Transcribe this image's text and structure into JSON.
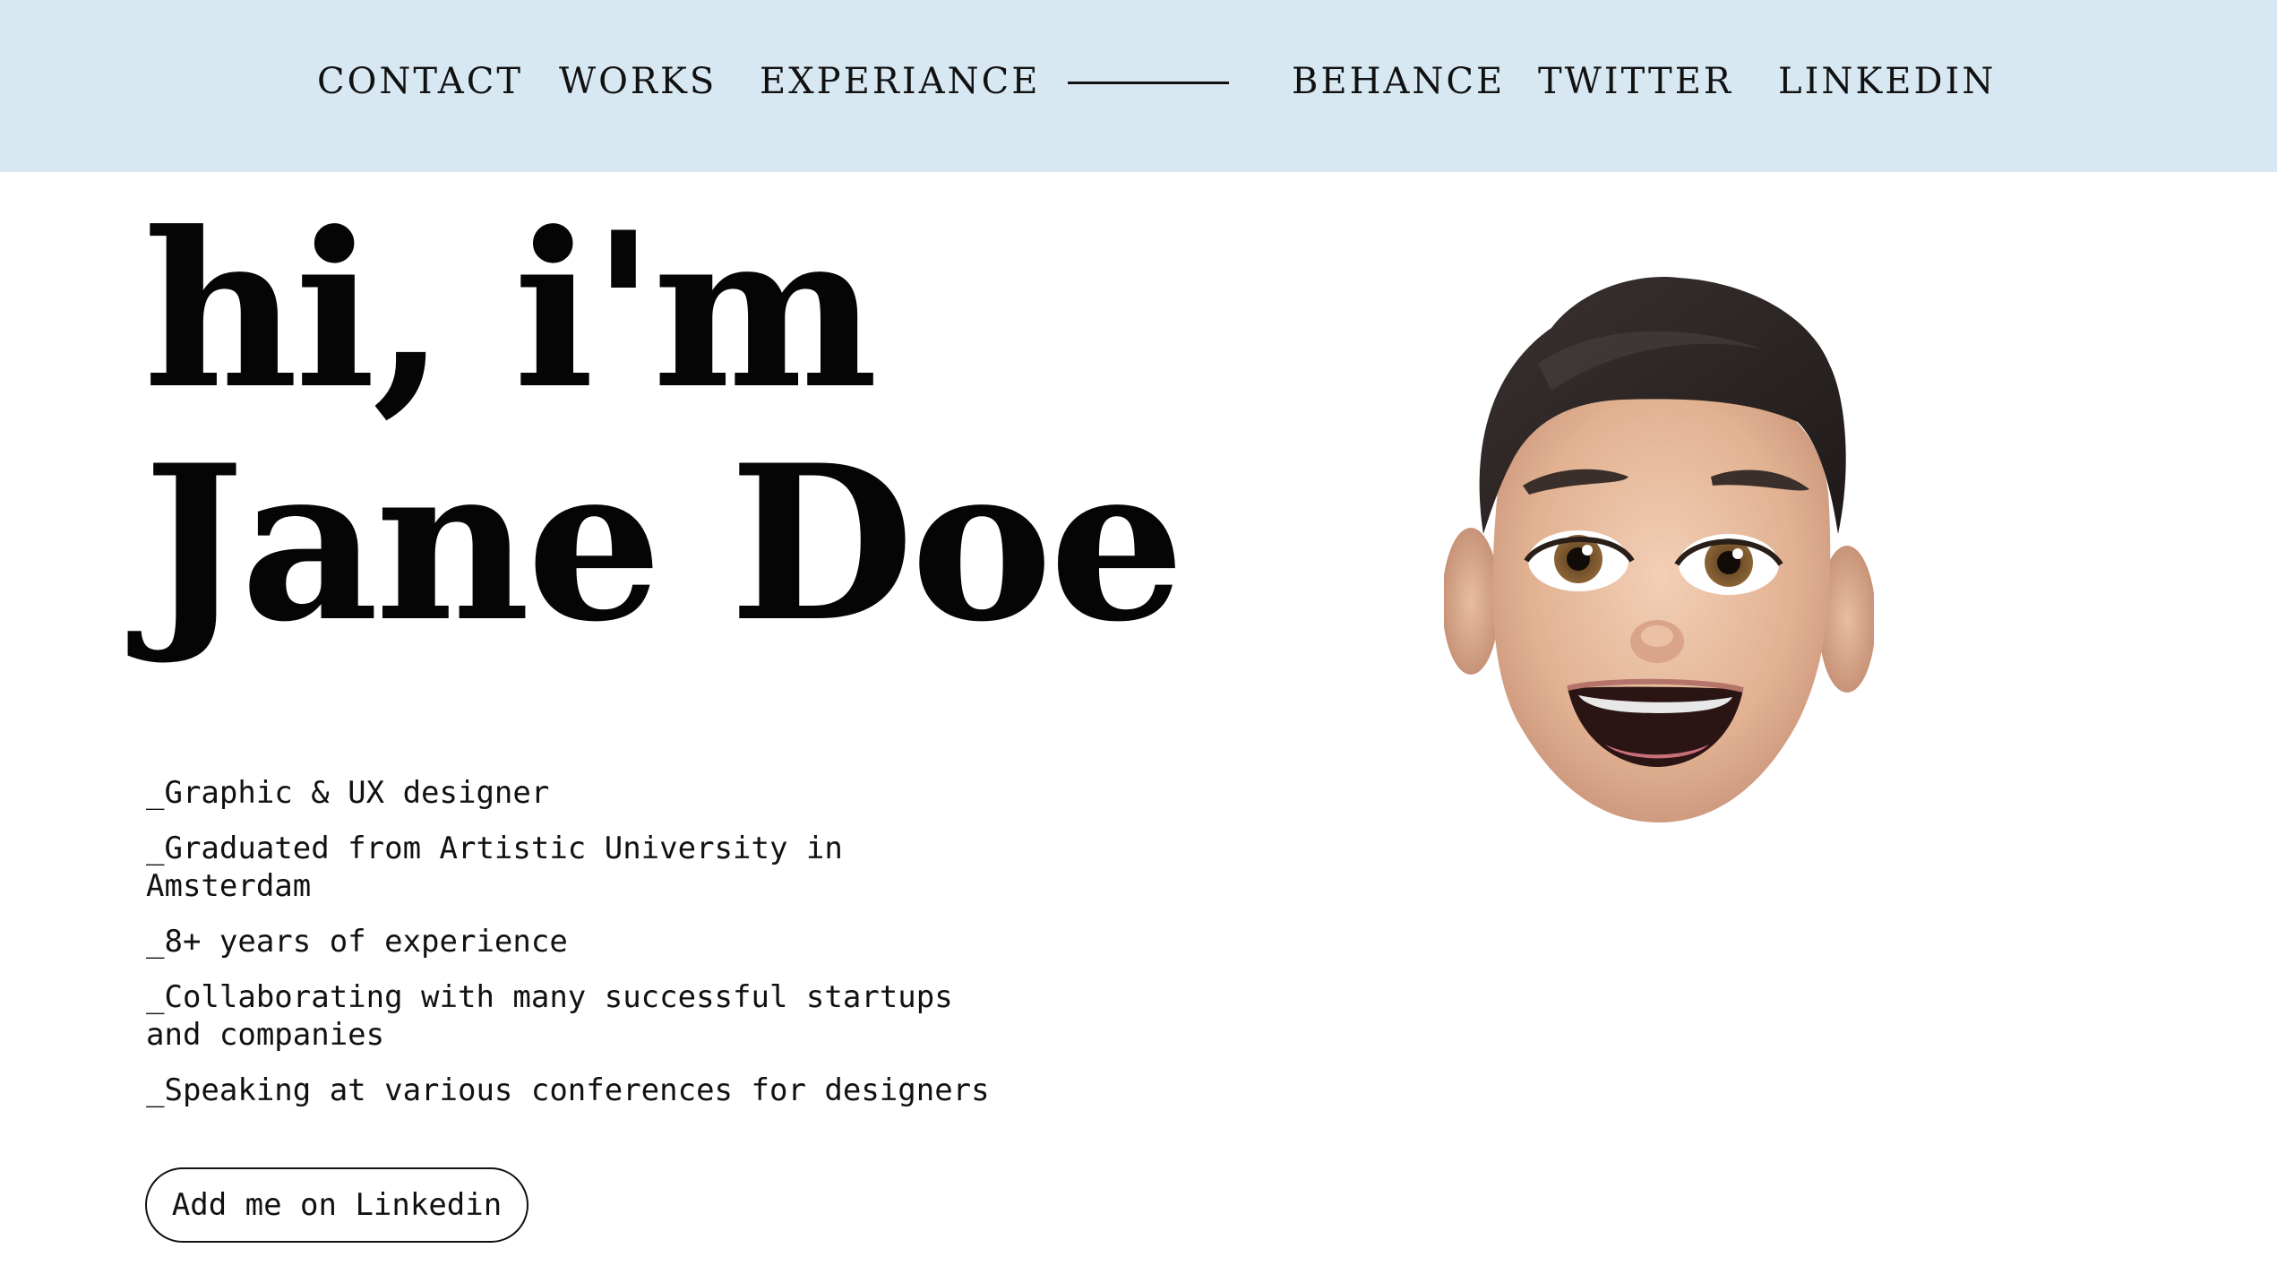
{
  "nav": {
    "left": [
      "CONTACT",
      "WORKS",
      "EXPERIANCE"
    ],
    "right": [
      "BEHANCE",
      "TWITTER",
      "LINKEDIN"
    ]
  },
  "hero": {
    "line1": "hi, i'm",
    "line2": "Jane Doe"
  },
  "bio": [
    "_Graphic & UX designer",
    "_Graduated from Artistic University in Amsterdam",
    "_8+ years of experience",
    "_Collaborating with many successful startups and companies",
    "_Speaking at various conferences for designers"
  ],
  "cta": {
    "label": "Add me on Linkedin"
  },
  "colors": {
    "header_bg": "#d8e8f2",
    "text": "#111111"
  },
  "icons": {
    "avatar": "memoji-avatar-icon"
  }
}
